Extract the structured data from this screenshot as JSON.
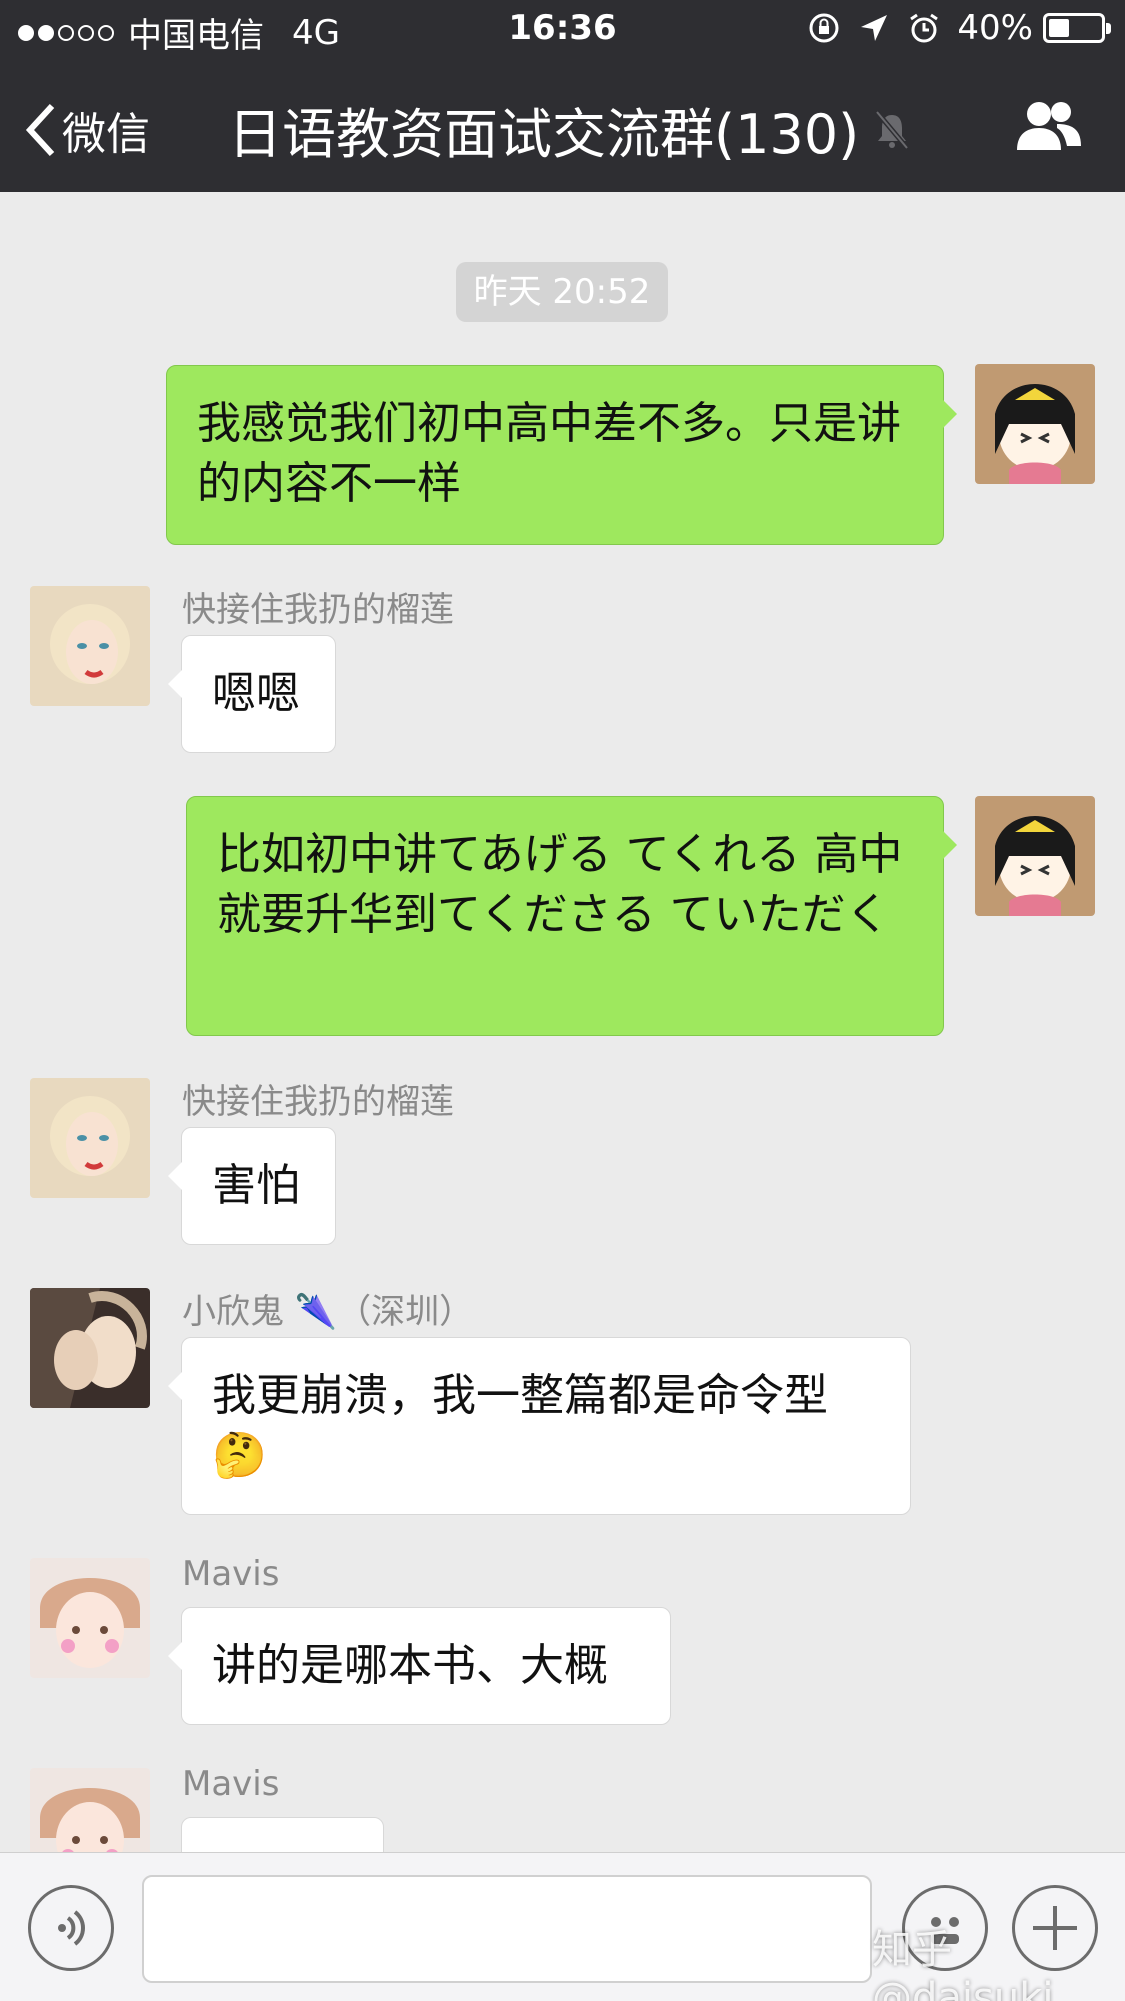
{
  "status_bar": {
    "carrier": "中国电信",
    "network": "4G",
    "time": "16:36",
    "battery": "40%"
  },
  "nav": {
    "back_label": "微信",
    "title": "日语教资面试交流群(130)"
  },
  "chat": {
    "timestamp": "昨天 20:52",
    "messages": [
      {
        "side": "out",
        "text": "我感觉我们初中高中差不多。只是讲的内容不一样"
      },
      {
        "side": "in",
        "sender": "快接住我扔的榴莲",
        "text": "嗯嗯"
      },
      {
        "side": "out",
        "text": "比如初中讲てあげる てくれる 高中就要升华到てくださる ていただく"
      },
      {
        "side": "in",
        "sender": "快接住我扔的榴莲",
        "text": "害怕"
      },
      {
        "side": "in",
        "sender": "小欣鬼 🌂（深圳）",
        "text": "我更崩溃，我一整篇都是命令型🤔"
      },
      {
        "side": "in",
        "sender": "Mavis",
        "text": "讲的是哪本书、大概"
      },
      {
        "side": "in",
        "sender": "Mavis",
        "text": ""
      }
    ]
  },
  "input_bar": {
    "placeholder": "",
    "watermark": "知乎 @daisuki"
  },
  "colors": {
    "bar_bg": "#2e2e32",
    "chat_bg": "#ebebeb",
    "out_bubble": "#9ee85e",
    "in_bubble": "#ffffff"
  }
}
